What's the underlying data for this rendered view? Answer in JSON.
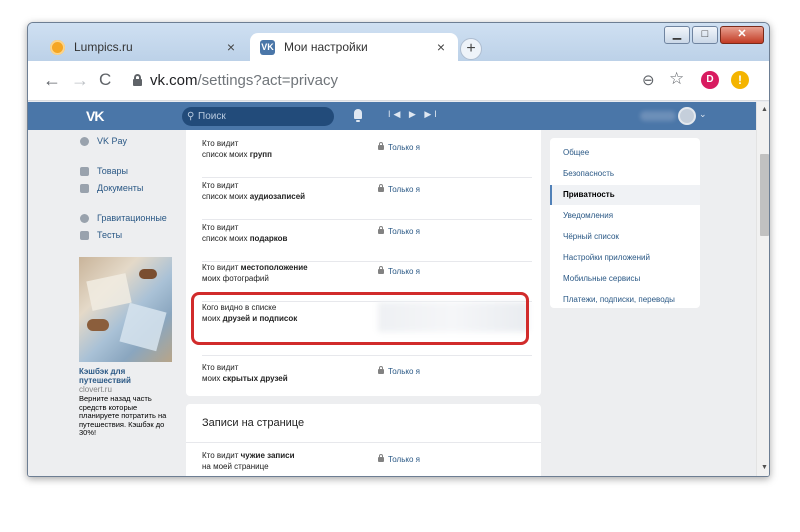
{
  "browser": {
    "tabs": [
      {
        "title": "Lumpics.ru",
        "close": "×"
      },
      {
        "title": "Мои настройки",
        "favicon": "VK",
        "close": "×"
      }
    ],
    "new_tab": "+",
    "window_controls": {
      "minimize": "▁",
      "maximize": "□",
      "close": "✕"
    },
    "nav": {
      "back": "←",
      "forward": "→",
      "reload": "C"
    },
    "url_host": "vk.com",
    "url_path": "/settings?act=privacy",
    "zoom": "⊖",
    "star": "☆",
    "profile_initial": "D",
    "extension_badge": "!"
  },
  "vk_header": {
    "logo": "VK",
    "search_placeholder": "Поиск",
    "player": "I◀ ▶ ▶I",
    "chevron": "⌄"
  },
  "left_nav": [
    {
      "label": "VK Pay",
      "icon": "vkpay-icon"
    },
    {
      "label": "Товары",
      "icon": "shop-icon"
    },
    {
      "label": "Документы",
      "icon": "document-icon"
    },
    {
      "label": "Гравитационные",
      "icon": "person-icon"
    },
    {
      "label": "Тесты",
      "icon": "apps-icon"
    }
  ],
  "ad": {
    "title": "Кэшбэк для путешествий",
    "site": "clovert.ru",
    "text": "Верните назад часть средств которые планируете потратить на путешествия. Кэшбэк до 30%!"
  },
  "privacy_rows": [
    {
      "line1": "Кто видит",
      "line2_prefix": "список моих ",
      "line2_bold": "групп",
      "value": "Только я"
    },
    {
      "line1": "Кто видит",
      "line2_prefix": "список моих ",
      "line2_bold": "аудиозаписей",
      "value": "Только я"
    },
    {
      "line1": "Кто видит",
      "line2_prefix": "список моих ",
      "line2_bold": "подарков",
      "value": "Только я"
    },
    {
      "line1_prefix": "Кто видит ",
      "line1_bold": "местоположение",
      "line2": "моих фотографий",
      "value": "Только я"
    },
    {
      "line1": "Кого видно в списке",
      "line2_prefix": "моих ",
      "line2_bold": "друзей и подписок",
      "value": ""
    },
    {
      "line1": "Кто видит",
      "line2_prefix": "моих ",
      "line2_bold": "скрытых друзей",
      "value": "Только я"
    }
  ],
  "section2": {
    "title": "Записи на странице",
    "row": {
      "line1_prefix": "Кто видит ",
      "line1_bold": "чужие записи",
      "line2": "на моей странице",
      "value": "Только я"
    }
  },
  "right_menu": [
    {
      "label": "Общее",
      "active": false
    },
    {
      "label": "Безопасность",
      "active": false
    },
    {
      "label": "Приватность",
      "active": true
    },
    {
      "label": "Уведомления",
      "active": false
    },
    {
      "label": "Чёрный список",
      "active": false
    },
    {
      "label": "Настройки приложений",
      "active": false
    },
    {
      "label": "Мобильные сервисы",
      "active": false
    },
    {
      "label": "Платежи, подписки, переводы",
      "active": false
    }
  ],
  "scrollbar": {
    "up": "▲",
    "down": "▼"
  },
  "colors": {
    "vk_blue": "#4a76a8",
    "link": "#2a5885",
    "highlight": "#d12b2b"
  }
}
